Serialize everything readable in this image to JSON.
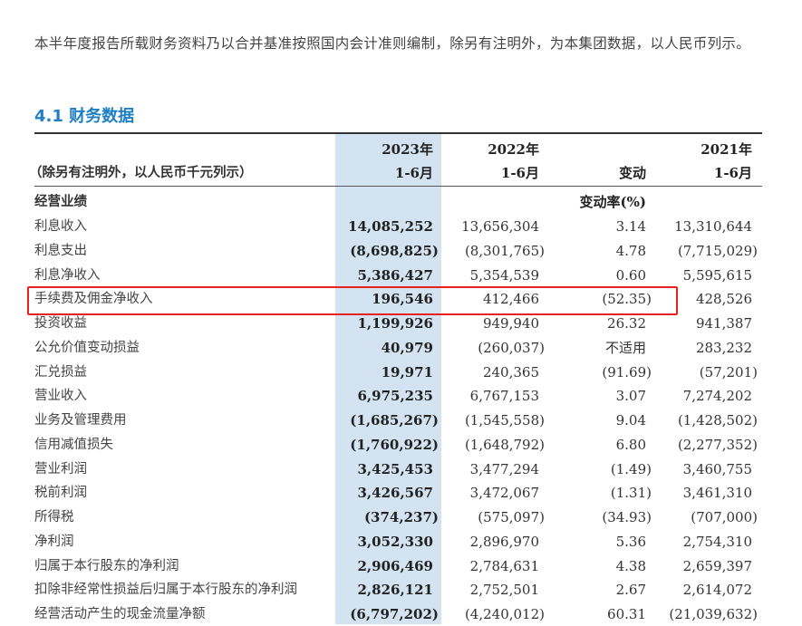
{
  "intro": "本半年度报告所载财务资料乃以合并基准按照国内会计准则编制，除另有注明外，为本集团数据，以人民币列示。",
  "heading": "4.1 财务数据",
  "header": {
    "unit_note": "（除另有注明外，以人民币千元列示）",
    "col1": [
      "2023年",
      "1-6月"
    ],
    "col2": [
      "2022年",
      "1-6月"
    ],
    "col3": "变动",
    "col4": [
      "2021年",
      "1-6月"
    ]
  },
  "section": {
    "label": "经营业绩",
    "change_header": "变动率(%)"
  },
  "rows": [
    [
      "利息收入",
      "14,085,252",
      "13,656,304",
      "3.14",
      "13,310,644"
    ],
    [
      "利息支出",
      "(8,698,825)",
      "(8,301,765)",
      "4.78",
      "(7,715,029)"
    ],
    [
      "利息净收入",
      "5,386,427",
      "5,354,539",
      "0.60",
      "5,595,615"
    ],
    [
      "手续费及佣金净收入",
      "196,546",
      "412,466",
      "(52.35)",
      "428,526"
    ],
    [
      "投资收益",
      "1,199,926",
      "949,940",
      "26.32",
      "941,387"
    ],
    [
      "公允价值变动损益",
      "40,979",
      "(260,037)",
      "不适用",
      "283,232"
    ],
    [
      "汇兑损益",
      "19,971",
      "240,365",
      "(91.69)",
      "(57,201)"
    ],
    [
      "营业收入",
      "6,975,235",
      "6,767,153",
      "3.07",
      "7,274,202"
    ],
    [
      "业务及管理费用",
      "(1,685,267)",
      "(1,545,558)",
      "9.04",
      "(1,428,502)"
    ],
    [
      "信用减值损失",
      "(1,760,922)",
      "(1,648,792)",
      "6.80",
      "(2,277,352)"
    ],
    [
      "营业利润",
      "3,425,453",
      "3,477,294",
      "(1.49)",
      "3,460,755"
    ],
    [
      "税前利润",
      "3,426,567",
      "3,472,067",
      "(1.31)",
      "3,461,310"
    ],
    [
      "所得税",
      "(374,237)",
      "(575,097)",
      "(34.93)",
      "(707,000)"
    ],
    [
      "净利润",
      "3,052,330",
      "2,896,970",
      "5.36",
      "2,754,310"
    ],
    [
      "归属于本行股东的净利润",
      "2,906,469",
      "2,784,631",
      "4.38",
      "2,659,397"
    ],
    [
      "扣除非经常性损益后归属于本行股东的净利润",
      "2,826,121",
      "2,752,501",
      "2.67",
      "2,614,072"
    ],
    [
      "经营活动产生的现金流量净额",
      "(6,797,202)",
      "(4,240,012)",
      "60.31",
      "(21,039,632)"
    ]
  ],
  "highlight_row": 3,
  "colors": {
    "accent": "#1f7fc4",
    "highlight_col": "#d3e3f1",
    "box": "#e8231f"
  }
}
